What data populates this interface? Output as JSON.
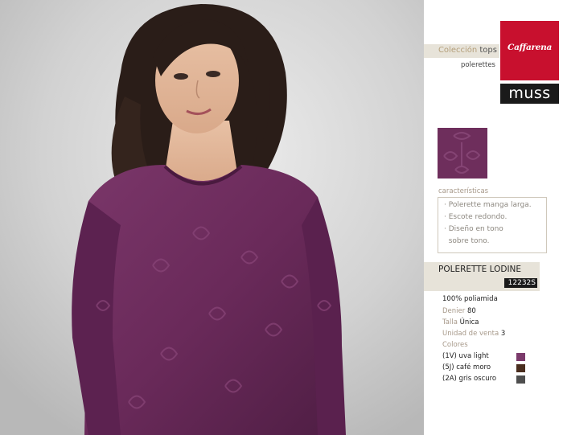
{
  "collection": {
    "label": "Colección",
    "category": "tops",
    "subcategory": "polerettes"
  },
  "brands": {
    "primary": "Caffarena",
    "secondary": "muss"
  },
  "features": {
    "label": "características",
    "items": [
      "· Polerette manga larga.",
      "· Escote redondo.",
      "· Diseño en tono",
      "  sobre tono."
    ]
  },
  "product": {
    "name": "POLERETTE LODINE",
    "code": "12232S",
    "composition": "100% poliamida",
    "denier_label": "Denier",
    "denier": "80",
    "size_label": "Talla",
    "size": "Única",
    "unit_label": "Unidad de venta",
    "unit": "3",
    "colors_label": "Colores",
    "colors": [
      {
        "label": "(1V) uva light",
        "hex": "#7b3a6b"
      },
      {
        "label": "(5J) café moro",
        "hex": "#4a2e1f"
      },
      {
        "label": "(2A) gris oscuro",
        "hex": "#4e4e4e"
      }
    ]
  },
  "accent_colors": {
    "brand_red": "#c8102e",
    "fabric": "#6e2e5c",
    "panel": "#e7e3d9"
  }
}
